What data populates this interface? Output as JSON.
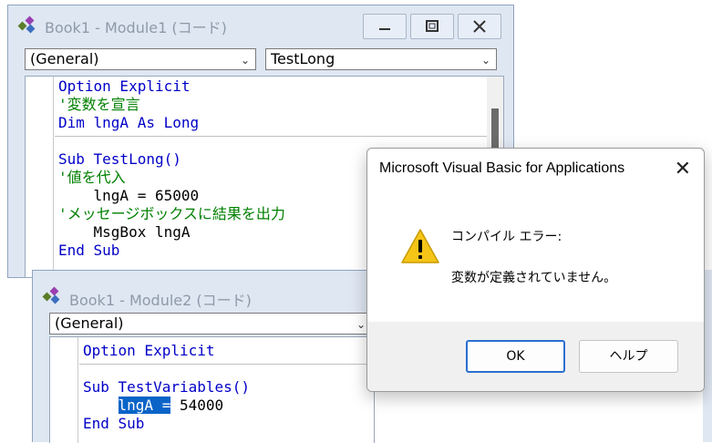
{
  "window1": {
    "title": "Book1 - Module1 (コード)",
    "object_combo": "(General)",
    "proc_combo": "TestLong",
    "code_lines": [
      {
        "cls": "kw",
        "text": "Option Explicit"
      },
      {
        "cls": "cm",
        "text": "'変数を宣言"
      },
      {
        "cls": "kw",
        "text": "Dim lngA As Long"
      },
      {
        "cls": "kw",
        "text": "Sub TestLong()"
      },
      {
        "cls": "cm",
        "text": "'値を代入"
      },
      {
        "cls": "tx",
        "text": "    lngA = 65000"
      },
      {
        "cls": "cm",
        "text": "'メッセージボックスに結果を出力"
      },
      {
        "cls": "tx",
        "text": "    MsgBox lngA"
      },
      {
        "cls": "kw",
        "text": "End Sub"
      }
    ]
  },
  "window2": {
    "title": "Book1 - Module2 (コード)",
    "object_combo": "(General)",
    "line_option": "Option Explicit",
    "line_sub": "Sub TestVariables()",
    "line_assign_selected": "lngA =",
    "line_assign_rest": " 54000",
    "line_end": "End Sub"
  },
  "dialog": {
    "title": "Microsoft Visual Basic for Applications",
    "close_glyph": "✕",
    "heading": "コンパイル エラー:",
    "message": "変数が定義されていません。",
    "ok_label": "OK",
    "help_label": "ヘルプ"
  },
  "colors": {
    "keyword": "#0000c8",
    "comment": "#008000",
    "selection": "#0a64c8",
    "warning": "#f5c518"
  }
}
